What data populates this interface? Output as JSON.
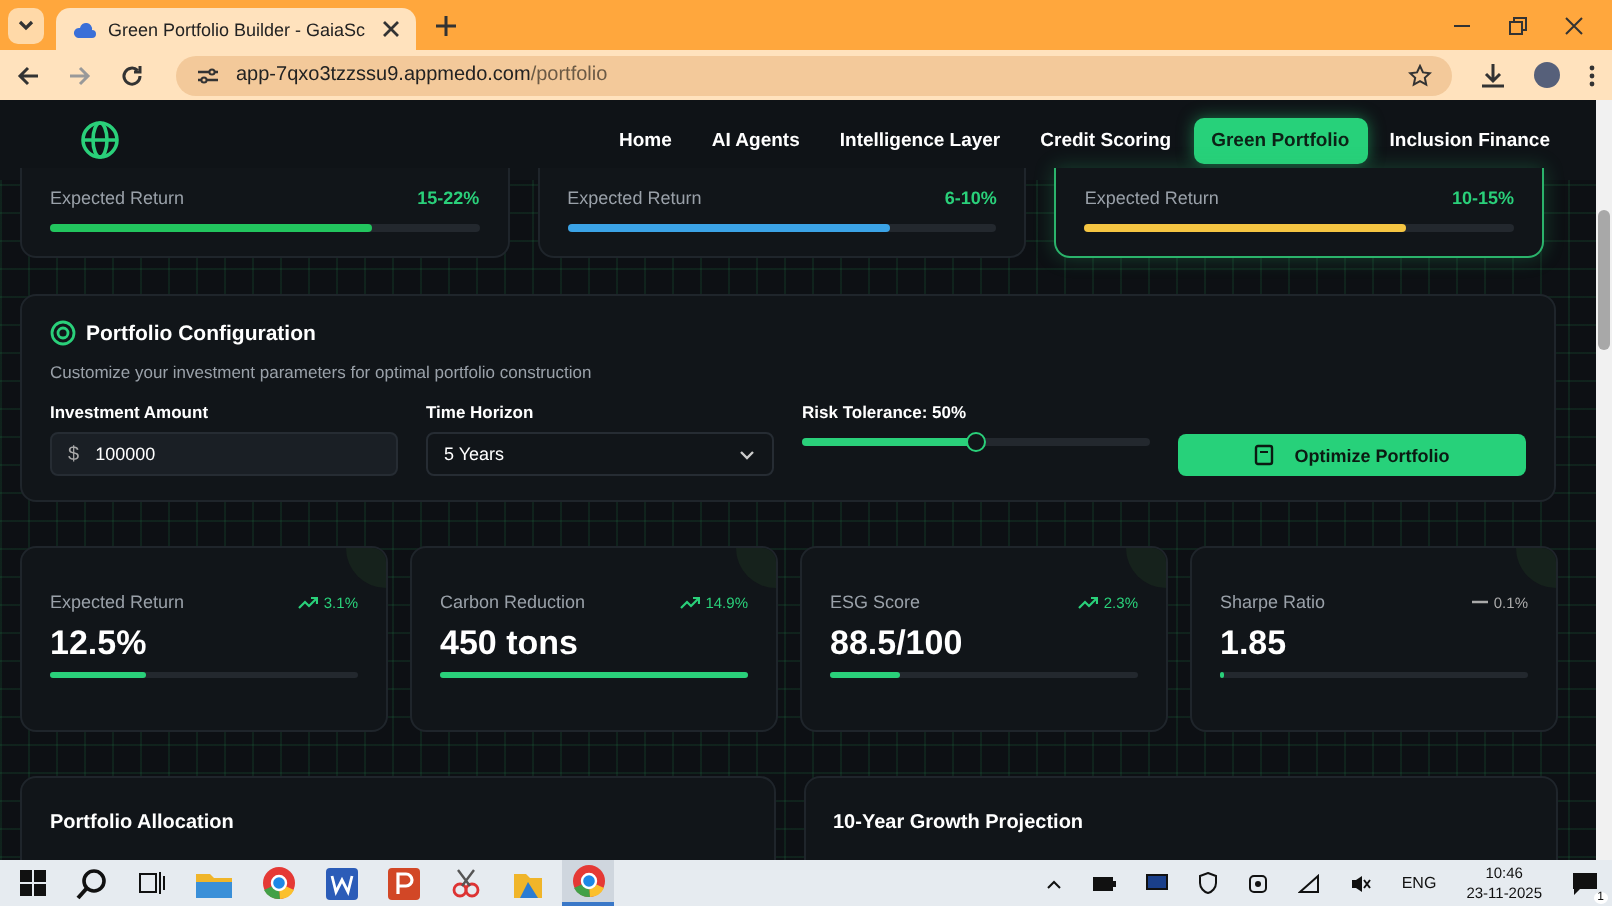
{
  "browser": {
    "tab_title": "Green Portfolio Builder - GaiaSc",
    "url_host": "app-7qxo3tzzssu9.appmedo.com",
    "url_path": "/portfolio"
  },
  "nav": {
    "items": [
      {
        "label": "Home",
        "selected": false
      },
      {
        "label": "AI Agents",
        "selected": false
      },
      {
        "label": "Intelligence Layer",
        "selected": false
      },
      {
        "label": "Credit Scoring",
        "selected": false
      },
      {
        "label": "Green Portfolio",
        "selected": true
      },
      {
        "label": "Inclusion Finance",
        "selected": false
      }
    ]
  },
  "strategy_cards": [
    {
      "label": "Expected Return",
      "value": "15-22%",
      "level": 0.75,
      "color": "#22c55e",
      "selected": false
    },
    {
      "label": "Expected Return",
      "value": "6-10%",
      "level": 0.75,
      "color": "#3ba3e6",
      "selected": false
    },
    {
      "label": "Expected Return",
      "value": "10-15%",
      "level": 0.75,
      "color": "#f5c542",
      "selected": true
    }
  ],
  "config": {
    "title": "Portfolio Configuration",
    "subtitle": "Customize your investment parameters for optimal portfolio construction",
    "amount_label": "Investment Amount",
    "currency": "$",
    "amount_value": "100000",
    "horizon_label": "Time Horizon",
    "horizon_value": "5 Years",
    "risk_label": "Risk Tolerance: 50%",
    "risk_slider": {
      "level": 0.5
    },
    "button": "Optimize Portfolio"
  },
  "metrics": [
    {
      "label": "Expected Return",
      "value": "12.5%",
      "change": "3.1%",
      "kind": "up",
      "level": 0.31
    },
    {
      "label": "Carbon Reduction",
      "value": "450 tons",
      "change": "14.9%",
      "kind": "up",
      "level": 1
    },
    {
      "label": "ESG Score",
      "value": "88.5/100",
      "change": "2.3%",
      "kind": "up",
      "level": 0.23
    },
    {
      "label": "Sharpe Ratio",
      "value": "1.85",
      "change": "0.1%",
      "kind": "flat",
      "level": 0.01
    }
  ],
  "panels": [
    {
      "title": "Portfolio Allocation"
    },
    {
      "title": "10-Year Growth Projection"
    }
  ],
  "taskbar": {
    "language": "ENG",
    "time": "10:46",
    "date": "23-11-2025",
    "notifications": "1"
  }
}
